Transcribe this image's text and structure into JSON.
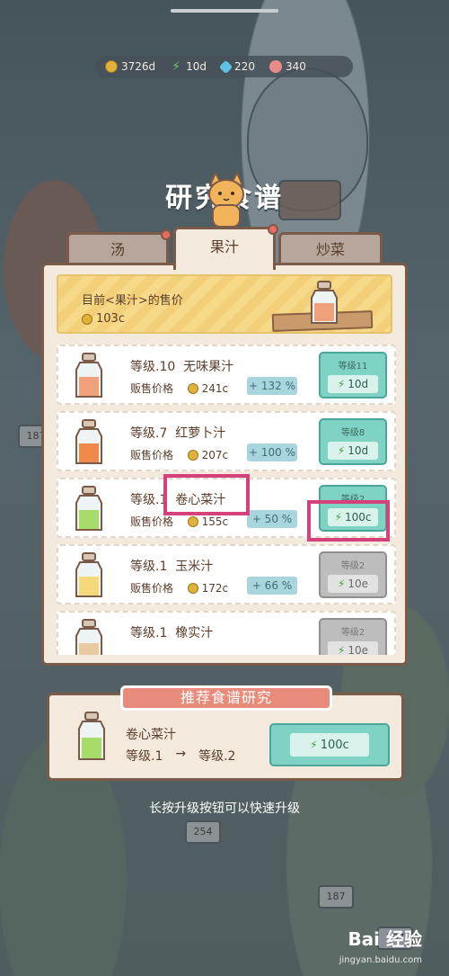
{
  "currency": {
    "coins": "3726d",
    "energy": "10d",
    "gems": "220",
    "brains": "340"
  },
  "title": "研究食谱",
  "tabs": [
    {
      "label": "汤",
      "active": false
    },
    {
      "label": "果汁",
      "active": true
    },
    {
      "label": "炒菜",
      "active": false
    }
  ],
  "price_banner": {
    "label": "目前<果汁>的售价",
    "value": "103c"
  },
  "sale_label": "贩售价格",
  "recipes": [
    {
      "level": "等级.10",
      "name": "无味果汁",
      "price": "241c",
      "bonus": "+ 132 %",
      "next_level": "等级11",
      "cost": "10d",
      "available": true,
      "liquid": "#f0a07a"
    },
    {
      "level": "等级.7",
      "name": "红萝卜汁",
      "price": "207c",
      "bonus": "+ 100 %",
      "next_level": "等级8",
      "cost": "10d",
      "available": true,
      "liquid": "#f08a4a"
    },
    {
      "level": "等级.1",
      "name": "卷心菜汁",
      "price": "155c",
      "bonus": "+ 50 %",
      "next_level": "等级2",
      "cost": "100c",
      "available": true,
      "liquid": "#a8dc6a"
    },
    {
      "level": "等级.1",
      "name": "玉米汁",
      "price": "172c",
      "bonus": "+ 66 %",
      "next_level": "等级2",
      "cost": "10e",
      "available": false,
      "liquid": "#f4d87a"
    },
    {
      "level": "等级.1",
      "name": "橡实汁",
      "price": "",
      "bonus": "",
      "next_level": "等级2",
      "cost": "10e",
      "available": false,
      "liquid": "#e8c9a0"
    }
  ],
  "recommend": {
    "header": "推荐食谱研究",
    "name": "卷心菜汁",
    "from_level": "等级.1",
    "arrow": "→",
    "to_level": "等级.2",
    "cost": "100c"
  },
  "hint": "长按升级按钮可以快速升级",
  "watermark": {
    "brand": "Bai 经验",
    "url": "jingyan.baidu.com"
  },
  "bg_signs": [
    "187",
    "254",
    "187",
    "187"
  ],
  "colors": {
    "accent": "#7fd3c4",
    "highlight": "#d5427b",
    "panel": "#f3e9dc",
    "frame": "#7a5a48"
  }
}
